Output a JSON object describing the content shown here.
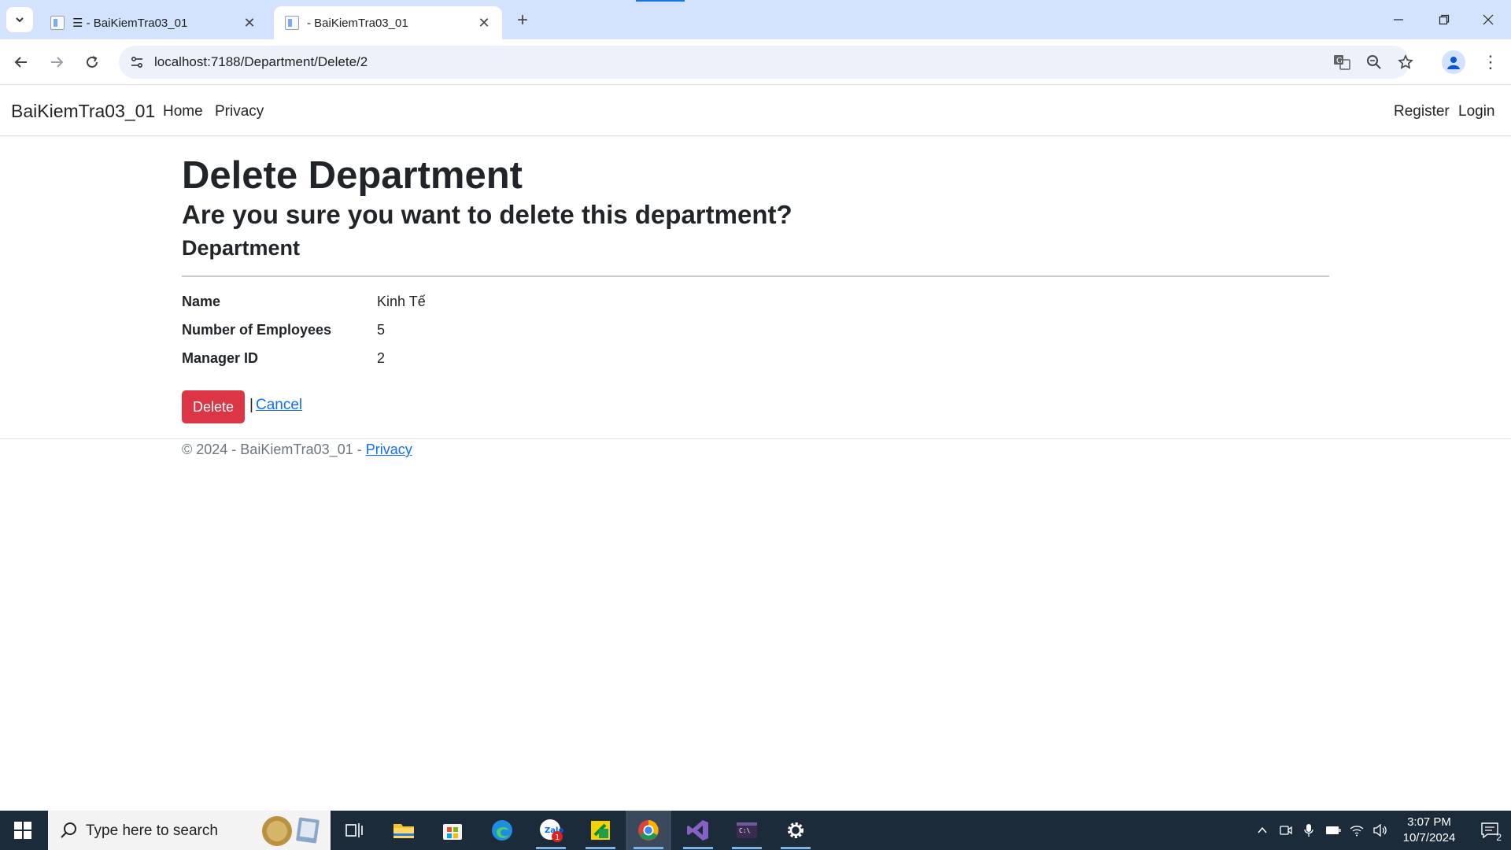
{
  "browser": {
    "tabs": [
      {
        "title": "☰ - BaiKiemTra03_01",
        "active": false
      },
      {
        "title": "- BaiKiemTra03_01",
        "active": true
      }
    ],
    "url": "localhost:7188/Department/Delete/2"
  },
  "site": {
    "brand": "BaiKiemTra03_01",
    "nav_left": [
      "Home",
      "Privacy"
    ],
    "nav_right": [
      "Register",
      "Login"
    ]
  },
  "page": {
    "title": "Delete Department",
    "question": "Are you sure you want to delete this department?",
    "section": "Department",
    "fields": [
      {
        "label": "Name",
        "value": "Kinh Tế"
      },
      {
        "label": "Number of Employees",
        "value": "5"
      },
      {
        "label": "Manager ID",
        "value": "2"
      }
    ],
    "delete_label": "Delete",
    "separator": "|",
    "cancel_label": "Cancel"
  },
  "footer": {
    "text": "© 2024 - BaiKiemTra03_01 - ",
    "link": "Privacy"
  },
  "taskbar": {
    "search_placeholder": "Type here to search",
    "time": "3:07 PM",
    "date": "10/7/2024",
    "notification_count": "2",
    "zalo_badge": "1"
  },
  "colors": {
    "delete_button": "#dc3545",
    "link": "#0d6efd",
    "tabstrip": "#d3e3fd",
    "taskbar": "#1c2b3a"
  }
}
